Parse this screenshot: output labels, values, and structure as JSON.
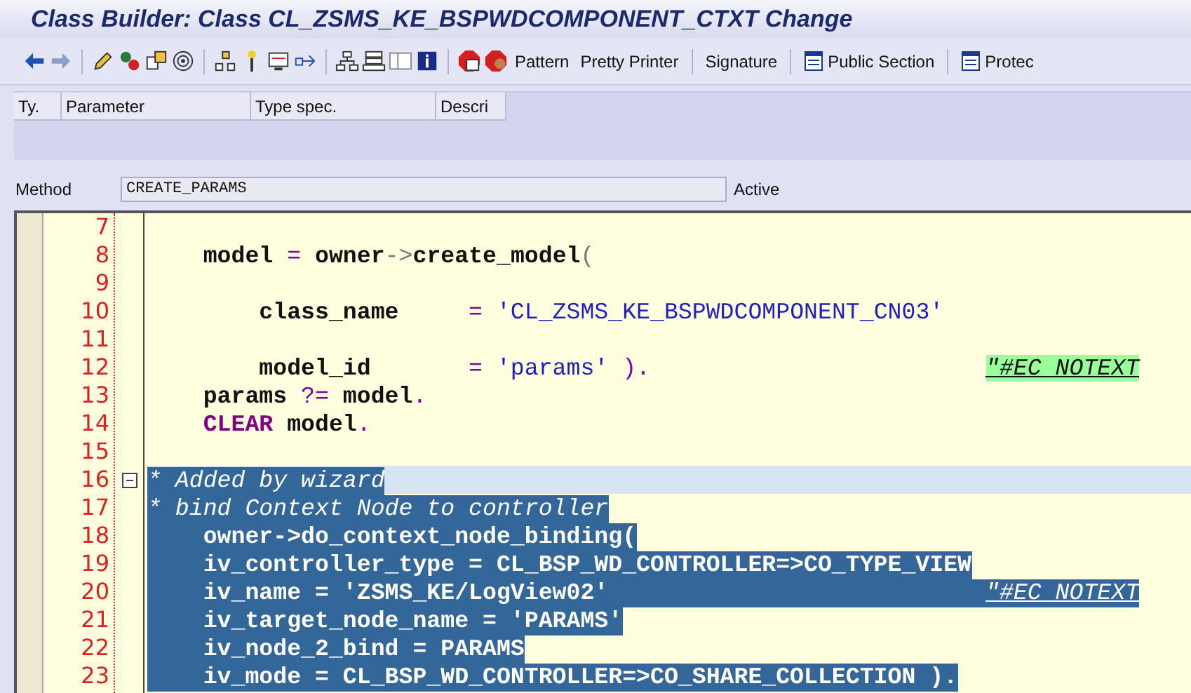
{
  "window": {
    "title": "Class Builder: Class CL_ZSMS_KE_BSPWDCOMPONENT_CTXT Change"
  },
  "toolbar": {
    "buttons": [
      {
        "label": "Pattern",
        "kind": "text"
      },
      {
        "label": "Pretty Printer",
        "kind": "text"
      },
      {
        "label": "Signature",
        "kind": "text"
      },
      {
        "label": "Public Section",
        "kind": "section"
      },
      {
        "label": "Protec",
        "kind": "section"
      }
    ]
  },
  "parameters_table": {
    "columns": [
      "Ty.",
      "Parameter",
      "Type spec.",
      "Descri"
    ]
  },
  "method": {
    "label": "Method",
    "value": "CREATE_PARAMS",
    "status": "Active"
  },
  "editor": {
    "lines": [
      {
        "number": "7"
      },
      {
        "number": "8",
        "selected": false,
        "current": false,
        "segments": [
          {
            "kind": "plain",
            "text": "    model "
          },
          {
            "kind": "op",
            "text": "="
          },
          {
            "kind": "plain",
            "text": " owner"
          },
          {
            "kind": "arrow",
            "text": "->"
          },
          {
            "kind": "plain",
            "text": "create_model"
          },
          {
            "kind": "arrow",
            "text": "("
          }
        ]
      },
      {
        "number": "9"
      },
      {
        "number": "10",
        "selected": false,
        "current": false,
        "segments": [
          {
            "kind": "plain",
            "text": "        class_name     "
          },
          {
            "kind": "op",
            "text": "="
          },
          {
            "kind": "string",
            "text": " 'CL_ZSMS_KE_BSPWDCOMPONENT_CN03'"
          }
        ]
      },
      {
        "number": "11"
      },
      {
        "number": "12",
        "selected": false,
        "current": false,
        "segments": [
          {
            "kind": "plain",
            "text": "        model_id       "
          },
          {
            "kind": "op",
            "text": "="
          },
          {
            "kind": "string",
            "text": " 'params'"
          },
          {
            "kind": "op",
            "text": " ).                        "
          },
          {
            "kind": "pragma",
            "text": "\"#EC NOTEXT"
          }
        ]
      },
      {
        "number": "13",
        "selected": false,
        "current": false,
        "segments": [
          {
            "kind": "plain",
            "text": "    params "
          },
          {
            "kind": "op",
            "text": "?="
          },
          {
            "kind": "plain",
            "text": " model"
          },
          {
            "kind": "op",
            "text": "."
          }
        ]
      },
      {
        "number": "14",
        "selected": false,
        "current": false,
        "segments": [
          {
            "kind": "keyword",
            "text": "    CLEAR"
          },
          {
            "kind": "plain",
            "text": " model"
          },
          {
            "kind": "op",
            "text": "."
          }
        ]
      },
      {
        "number": "15"
      },
      {
        "number": "16",
        "selected": true,
        "current": true,
        "fold": true,
        "segments": [
          {
            "kind": "comment",
            "text": "* Added by wizard"
          }
        ]
      },
      {
        "number": "17",
        "selected": true,
        "current": false,
        "segments": [
          {
            "kind": "comment",
            "text": "* bind Context Node to controller"
          }
        ]
      },
      {
        "number": "18",
        "selected": true,
        "current": false,
        "segments": [
          {
            "kind": "plain",
            "text": "    owner->do_context_node_binding("
          }
        ]
      },
      {
        "number": "19",
        "selected": true,
        "current": false,
        "segments": [
          {
            "kind": "plain",
            "text": "    iv_controller_type = CL_BSP_WD_CONTROLLER=>CO_TYPE_VIEW"
          }
        ]
      },
      {
        "number": "20",
        "selected": true,
        "current": false,
        "segments": [
          {
            "kind": "plain",
            "text": "    iv_name = 'ZSMS_KE/LogView02'                           "
          },
          {
            "kind": "pragma",
            "text": "\"#EC NOTEXT"
          }
        ]
      },
      {
        "number": "21",
        "selected": true,
        "current": false,
        "segments": [
          {
            "kind": "plain",
            "text": "    iv_target_node_name = 'PARAMS'"
          }
        ]
      },
      {
        "number": "22",
        "selected": true,
        "current": false,
        "segments": [
          {
            "kind": "plain",
            "text": "    iv_node_2_bind = PARAMS"
          }
        ]
      },
      {
        "number": "23",
        "selected": true,
        "current": false,
        "segments": [
          {
            "kind": "plain",
            "text": "    iv_mode = CL_BSP_WD_CONTROLLER=>CO_SHARE_COLLECTION )."
          }
        ]
      }
    ]
  }
}
